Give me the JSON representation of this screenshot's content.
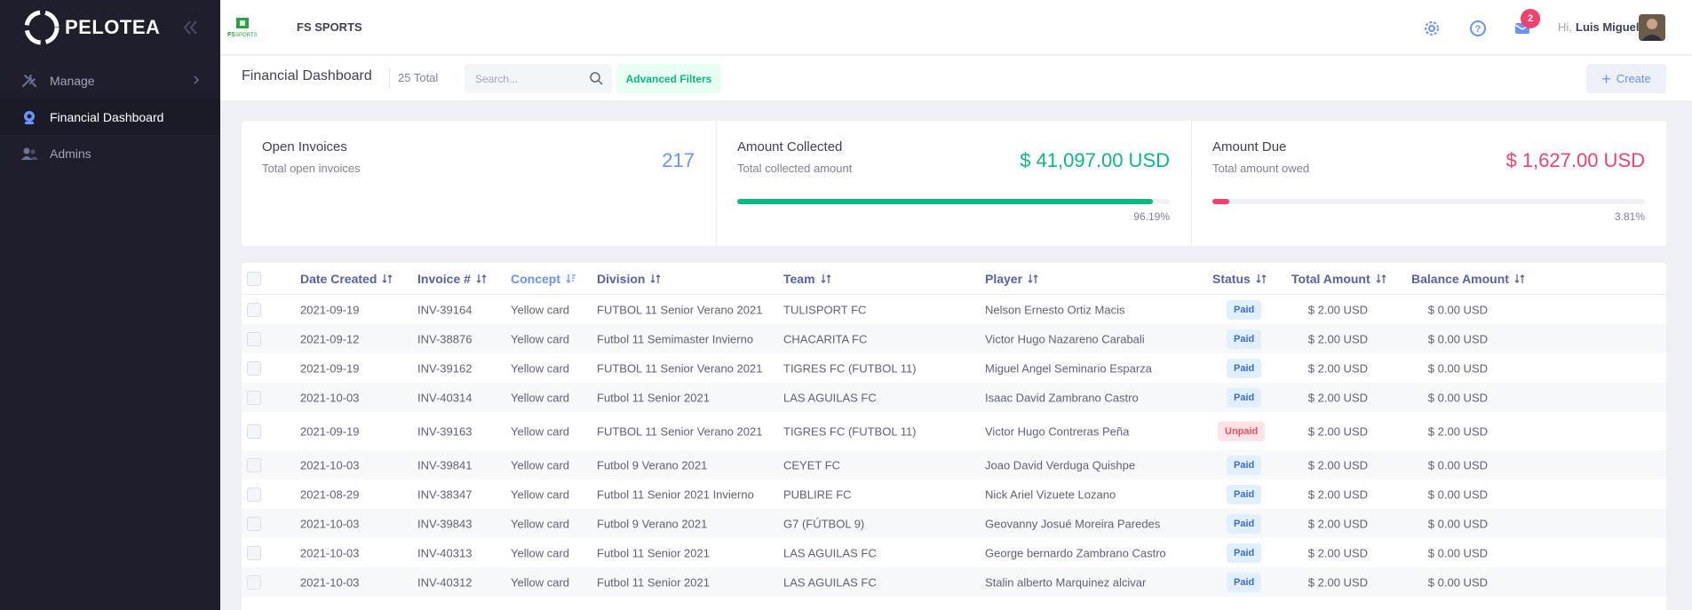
{
  "brand": {
    "name": "PELOTEA"
  },
  "sidebar": {
    "items": [
      {
        "label": "Manage",
        "icon": "tools-icon",
        "active": false,
        "has_submenu": true
      },
      {
        "label": "Financial Dashboard",
        "icon": "dashboard-icon",
        "active": true,
        "has_submenu": false
      },
      {
        "label": "Admins",
        "icon": "users-icon",
        "active": false,
        "has_submenu": false
      }
    ]
  },
  "topbar": {
    "org_name": "FS SPORTS",
    "notifications_count": "2",
    "greeting": "Hi,",
    "user_name": "Luis Miguel"
  },
  "subheader": {
    "title": "Financial Dashboard",
    "total": "25 Total",
    "search_placeholder": "Search...",
    "advanced_filters": "Advanced Filters",
    "create": "Create"
  },
  "stats": {
    "open_invoices": {
      "title": "Open Invoices",
      "subtitle": "Total open invoices",
      "value": "217"
    },
    "amount_collected": {
      "title": "Amount Collected",
      "subtitle": "Total collected amount",
      "value": "$ 41,097.00 USD",
      "percent": "96.19%",
      "progress": 96.19
    },
    "amount_due": {
      "title": "Amount Due",
      "subtitle": "Total amount owed",
      "value": "$ 1,627.00 USD",
      "percent": "3.81%",
      "progress": 3.81
    }
  },
  "colors": {
    "accent": "#6993ff",
    "success": "#1bc5bd",
    "danger": "#f1416c",
    "sidebar_bg": "#1e1e2d"
  },
  "table": {
    "columns": [
      "Date Created",
      "Invoice #",
      "Concept",
      "Division",
      "Team",
      "Player",
      "Status",
      "Total Amount",
      "Balance Amount"
    ],
    "rows": [
      {
        "date": "2021-09-19",
        "invoice": "INV-39164",
        "concept": "Yellow card",
        "division": "FUTBOL 11 Senior Verano 2021",
        "team": "TULISPORT FC",
        "player": "Nelson Ernesto Ortiz Macis",
        "status": "Paid",
        "total": "$ 2.00 USD",
        "balance": "$ 0.00 USD"
      },
      {
        "date": "2021-09-12",
        "invoice": "INV-38876",
        "concept": "Yellow card",
        "division": "Futbol 11 Semimaster Invierno",
        "team": "CHACARITA FC",
        "player": "Victor Hugo Nazareno Carabali",
        "status": "Paid",
        "total": "$ 2.00 USD",
        "balance": "$ 0.00 USD"
      },
      {
        "date": "2021-09-19",
        "invoice": "INV-39162",
        "concept": "Yellow card",
        "division": "FUTBOL 11 Senior Verano 2021",
        "team": "TIGRES FC (FUTBOL 11)",
        "player": "Miguel Angel Seminario Esparza",
        "status": "Paid",
        "total": "$ 2.00 USD",
        "balance": "$ 0.00 USD"
      },
      {
        "date": "2021-10-03",
        "invoice": "INV-40314",
        "concept": "Yellow card",
        "division": "Futbol 11 Senior 2021",
        "team": "LAS AGUILAS FC",
        "player": "Isaac David Zambrano Castro",
        "status": "Paid",
        "total": "$ 2.00 USD",
        "balance": "$ 0.00 USD"
      },
      {
        "date": "2021-09-19",
        "invoice": "INV-39163",
        "concept": "Yellow card",
        "division": "FUTBOL 11 Senior Verano 2021",
        "team": "TIGRES FC (FUTBOL 11)",
        "player": "Victor Hugo Contreras Peña",
        "status": "Unpaid",
        "total": "$ 2.00 USD",
        "balance": "$ 2.00 USD"
      },
      {
        "date": "2021-10-03",
        "invoice": "INV-39841",
        "concept": "Yellow card",
        "division": "Futbol 9 Verano 2021",
        "team": "CEYET FC",
        "player": "Joao David Verduga Quishpe",
        "status": "Paid",
        "total": "$ 2.00 USD",
        "balance": "$ 0.00 USD"
      },
      {
        "date": "2021-08-29",
        "invoice": "INV-38347",
        "concept": "Yellow card",
        "division": "Futbol 11 Senior 2021 Invierno",
        "team": "PUBLIRE FC",
        "player": "Nick Ariel Vizuete Lozano",
        "status": "Paid",
        "total": "$ 2.00 USD",
        "balance": "$ 0.00 USD"
      },
      {
        "date": "2021-10-03",
        "invoice": "INV-39843",
        "concept": "Yellow card",
        "division": "Futbol 9 Verano 2021",
        "team": "G7 (FÚTBOL 9)",
        "player": "Geovanny Josué Moreira Paredes",
        "status": "Paid",
        "total": "$ 2.00 USD",
        "balance": "$ 0.00 USD"
      },
      {
        "date": "2021-10-03",
        "invoice": "INV-40313",
        "concept": "Yellow card",
        "division": "Futbol 11 Senior 2021",
        "team": "LAS AGUILAS FC",
        "player": "George bernardo Zambrano Castro",
        "status": "Paid",
        "total": "$ 2.00 USD",
        "balance": "$ 0.00 USD"
      },
      {
        "date": "2021-10-03",
        "invoice": "INV-40312",
        "concept": "Yellow card",
        "division": "Futbol 11 Senior 2021",
        "team": "LAS AGUILAS FC",
        "player": "Stalin alberto Marquinez alcivar",
        "status": "Paid",
        "total": "$ 2.00 USD",
        "balance": "$ 0.00 USD"
      }
    ]
  }
}
